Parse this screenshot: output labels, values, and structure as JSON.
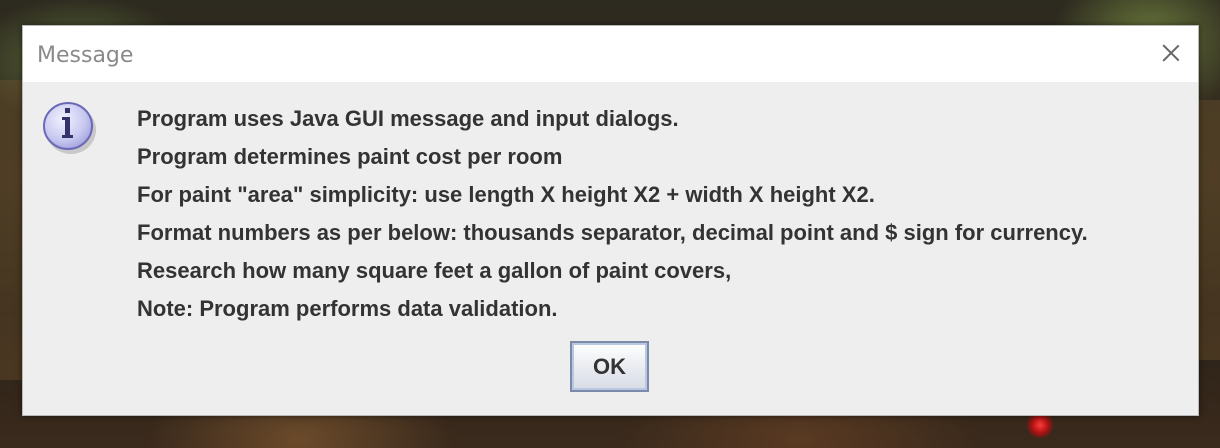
{
  "dialog": {
    "title": "Message",
    "icon": "information-icon",
    "close_icon": "close-icon",
    "lines": [
      "Program uses Java GUI message and input dialogs.",
      "Program determines paint cost per room",
      "For paint \"area\" simplicity: use length X height X2 + width X height X2.",
      "Format numbers as per below: thousands separator, decimal point and $ sign for currency.",
      "Research how many square feet a gallon of paint covers,",
      "Note: Program performs data validation."
    ],
    "ok_label": "OK"
  },
  "colors": {
    "dialog_background": "#eeeeee",
    "titlebar_background": "#ffffff",
    "title_text": "#8a8a8a",
    "message_text": "#333333",
    "icon_fill": "#c8c8f0",
    "icon_border": "#6a6ab8",
    "button_border": "#7a8aa8"
  }
}
